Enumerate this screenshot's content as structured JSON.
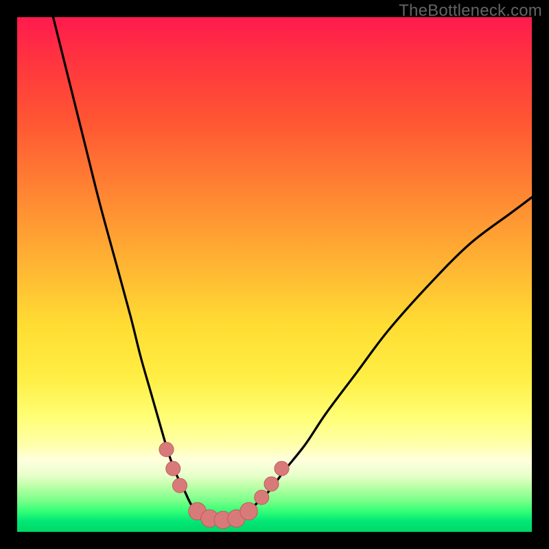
{
  "watermark": "TheBottleneck.com",
  "chart_data": {
    "type": "line",
    "title": "",
    "xlabel": "",
    "ylabel": "",
    "xlim": [
      0,
      100
    ],
    "ylim": [
      0,
      100
    ],
    "series": [
      {
        "name": "left-curve",
        "x": [
          7,
          10,
          13,
          16,
          19,
          22,
          24,
          26,
          28,
          29.5,
          31,
          32.5,
          34,
          36,
          38
        ],
        "y": [
          100,
          88,
          76,
          64,
          53,
          42,
          34,
          27,
          20,
          15,
          11,
          8,
          5,
          3,
          2
        ]
      },
      {
        "name": "right-curve",
        "x": [
          42,
          44,
          46,
          49,
          52,
          56,
          60,
          66,
          72,
          80,
          88,
          96,
          100
        ],
        "y": [
          2,
          3,
          5,
          8,
          12,
          17,
          23,
          31,
          39,
          48,
          56,
          62,
          65
        ]
      },
      {
        "name": "valley-floor",
        "x": [
          34,
          36,
          38,
          40,
          42,
          44,
          46
        ],
        "y": [
          5,
          3,
          2,
          2,
          2,
          3,
          5
        ]
      }
    ],
    "markers": [
      {
        "name": "left-marker-1",
        "x": 29.0,
        "y": 16.0,
        "r": 1.4
      },
      {
        "name": "left-marker-2",
        "x": 30.3,
        "y": 12.3,
        "r": 1.4
      },
      {
        "name": "left-marker-3",
        "x": 31.6,
        "y": 9.0,
        "r": 1.4
      },
      {
        "name": "valley-marker-1",
        "x": 35.0,
        "y": 4.0,
        "r": 1.7
      },
      {
        "name": "valley-marker-2",
        "x": 37.4,
        "y": 2.6,
        "r": 1.7
      },
      {
        "name": "valley-marker-3",
        "x": 40.0,
        "y": 2.3,
        "r": 1.7
      },
      {
        "name": "valley-marker-4",
        "x": 42.6,
        "y": 2.6,
        "r": 1.7
      },
      {
        "name": "valley-marker-5",
        "x": 45.0,
        "y": 4.0,
        "r": 1.7
      },
      {
        "name": "right-marker-1",
        "x": 47.5,
        "y": 6.7,
        "r": 1.4
      },
      {
        "name": "right-marker-2",
        "x": 49.4,
        "y": 9.3,
        "r": 1.4
      },
      {
        "name": "right-marker-3",
        "x": 51.4,
        "y": 12.3,
        "r": 1.4
      }
    ],
    "colors": {
      "curve": "#000000",
      "marker_fill": "#d97a7a",
      "marker_stroke": "#c05a5a"
    }
  }
}
